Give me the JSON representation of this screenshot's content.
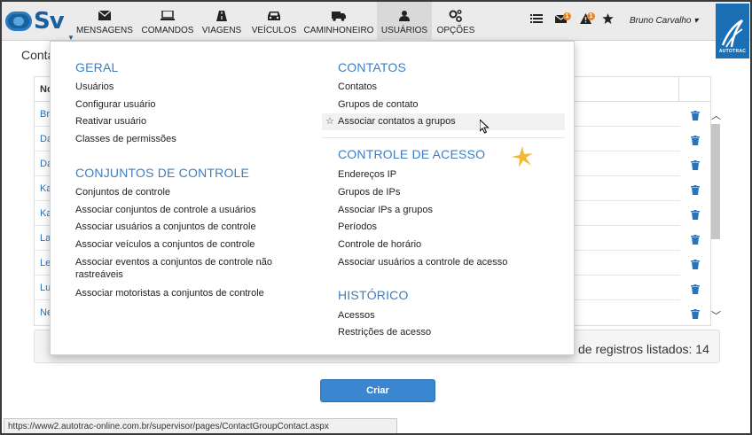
{
  "app": {
    "logo_text": "Sv",
    "user_name": "Bruno Carvalho ▾",
    "brand_text": "AUTOTRAC"
  },
  "nav": {
    "items": [
      {
        "label": "MENSAGENS",
        "icon": "envelope-icon"
      },
      {
        "label": "COMANDOS",
        "icon": "laptop-icon"
      },
      {
        "label": "VIAGENS",
        "icon": "road-icon"
      },
      {
        "label": "VEÍCULOS",
        "icon": "car-icon"
      },
      {
        "label": "CAMINHONEIRO",
        "icon": "truck-icon"
      },
      {
        "label": "USUÁRIOS",
        "icon": "user-icon"
      },
      {
        "label": "OPÇÕES",
        "icon": "gears-icon"
      }
    ],
    "badges": {
      "messages": "1",
      "alerts": "1"
    }
  },
  "page": {
    "title": "Conta",
    "column_header": "No",
    "rows": [
      "Br",
      "Da",
      "Da",
      "Ka",
      "Ka",
      "La",
      "Le",
      "Lu",
      "Ne"
    ],
    "records_text": "de registros listados: 14",
    "create_button": "Criar"
  },
  "dropdown": {
    "geral": {
      "title": "GERAL",
      "items": [
        "Usuários",
        "Configurar usuário",
        "Reativar usuário",
        "Classes de permissões"
      ]
    },
    "conjuntos": {
      "title": "CONJUNTOS DE CONTROLE",
      "items": [
        "Conjuntos de controle",
        "Associar conjuntos de controle a usuários",
        "Associar usuários a conjuntos de controle",
        "Associar veículos a conjuntos de controle",
        "Associar eventos a conjuntos de controle não",
        "rastreáveis",
        "Associar motoristas a conjuntos de controle"
      ]
    },
    "contatos": {
      "title": "CONTATOS",
      "items": [
        "Contatos",
        "Grupos de contato",
        "Associar contatos a grupos"
      ]
    },
    "controle_acesso": {
      "title": "CONTROLE DE ACESSO",
      "items": [
        "Endereços IP",
        "Grupos de IPs",
        "Associar IPs a grupos",
        "Períodos",
        "Controle de horário",
        "Associar usuários a controle de acesso"
      ]
    },
    "historico": {
      "title": "HISTÓRICO",
      "items": [
        "Acessos",
        "Restrições de acesso"
      ]
    }
  },
  "status_url": "https://www2.autotrac-online.com.br/supervisor/pages/ContactGroupContact.aspx",
  "colors": {
    "accent": "#3c7ec1",
    "nav_bg": "#ebebeb",
    "button": "#3a86d0",
    "badge": "#e8862b"
  }
}
